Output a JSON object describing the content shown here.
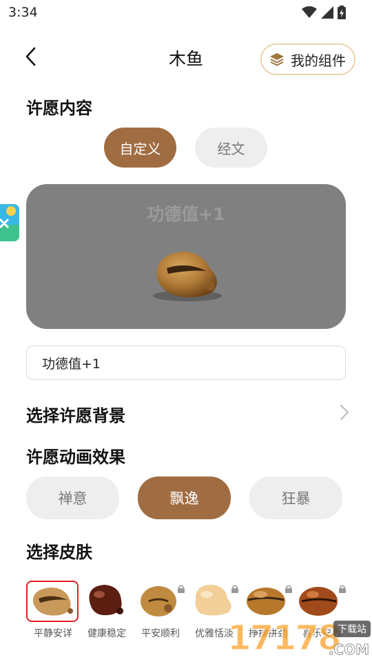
{
  "status": {
    "time": "3:34"
  },
  "header": {
    "title": "木鱼",
    "widget_label": "我的组件"
  },
  "wish": {
    "section_title": "许愿内容",
    "tabs": [
      {
        "label": "自定义",
        "active": true
      },
      {
        "label": "经文",
        "active": false
      }
    ],
    "preview_text": "功德值+1",
    "input_value": "功德值+1"
  },
  "background": {
    "label": "选择许愿背景"
  },
  "animation": {
    "section_title": "许愿动画效果",
    "options": [
      {
        "label": "禅意",
        "active": false
      },
      {
        "label": "飘逸",
        "active": true
      },
      {
        "label": "狂暴",
        "active": false
      }
    ]
  },
  "skins": {
    "section_title": "选择皮肤",
    "items": [
      {
        "label": "平静安详",
        "locked": false,
        "selected": true
      },
      {
        "label": "健康稳定",
        "locked": false,
        "selected": false
      },
      {
        "label": "平安顺利",
        "locked": true,
        "selected": false
      },
      {
        "label": "优雅恬淡",
        "locked": true,
        "selected": false
      },
      {
        "label": "挣揣拼劲",
        "locked": true,
        "selected": false
      },
      {
        "label": "喜乐安逸",
        "locked": true,
        "selected": false
      }
    ]
  },
  "watermark": {
    "digits": "17178",
    "tag": "下载站",
    "suffix": ".COM"
  },
  "colors": {
    "accent": "#a06c42",
    "inactive_pill": "#eeeeee",
    "preview_bg": "#808080",
    "widget_border": "#e9d3ae",
    "selected_border": "#e02020"
  }
}
